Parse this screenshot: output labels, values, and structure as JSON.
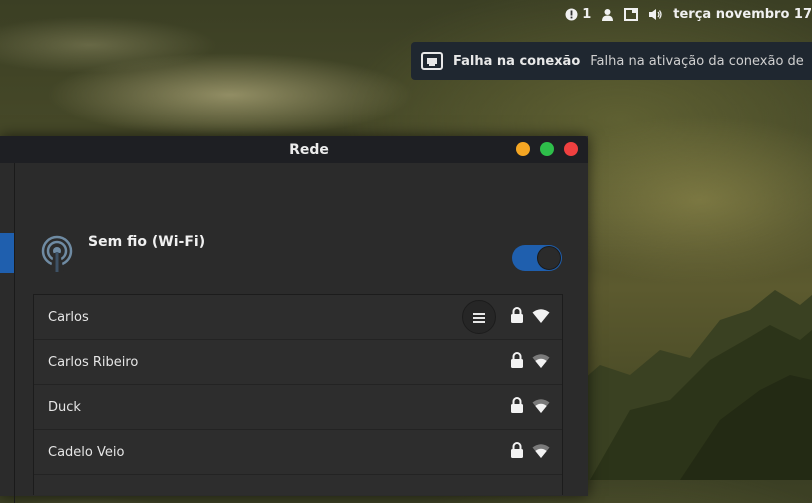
{
  "topbar": {
    "notification_count": "1",
    "datetime": "terça novembro 17"
  },
  "notification": {
    "title": "Falha na conexão",
    "body": "Falha na ativação da conexão de"
  },
  "window": {
    "title": "Rede"
  },
  "wifi": {
    "title": "Sem fio (Wi-Fi)",
    "enabled": true
  },
  "networks": [
    {
      "name": "Carlos",
      "secured": true,
      "signal": "strong",
      "has_menu": true
    },
    {
      "name": "Carlos Ribeiro",
      "secured": true,
      "signal": "medium"
    },
    {
      "name": "Duck",
      "secured": true,
      "signal": "medium"
    },
    {
      "name": "Cadelo Veio",
      "secured": true,
      "signal": "medium"
    }
  ],
  "colors": {
    "accent": "#1f5fae",
    "minimize": "#f5a623",
    "maximize": "#2ebe4a",
    "close": "#ef4040"
  }
}
